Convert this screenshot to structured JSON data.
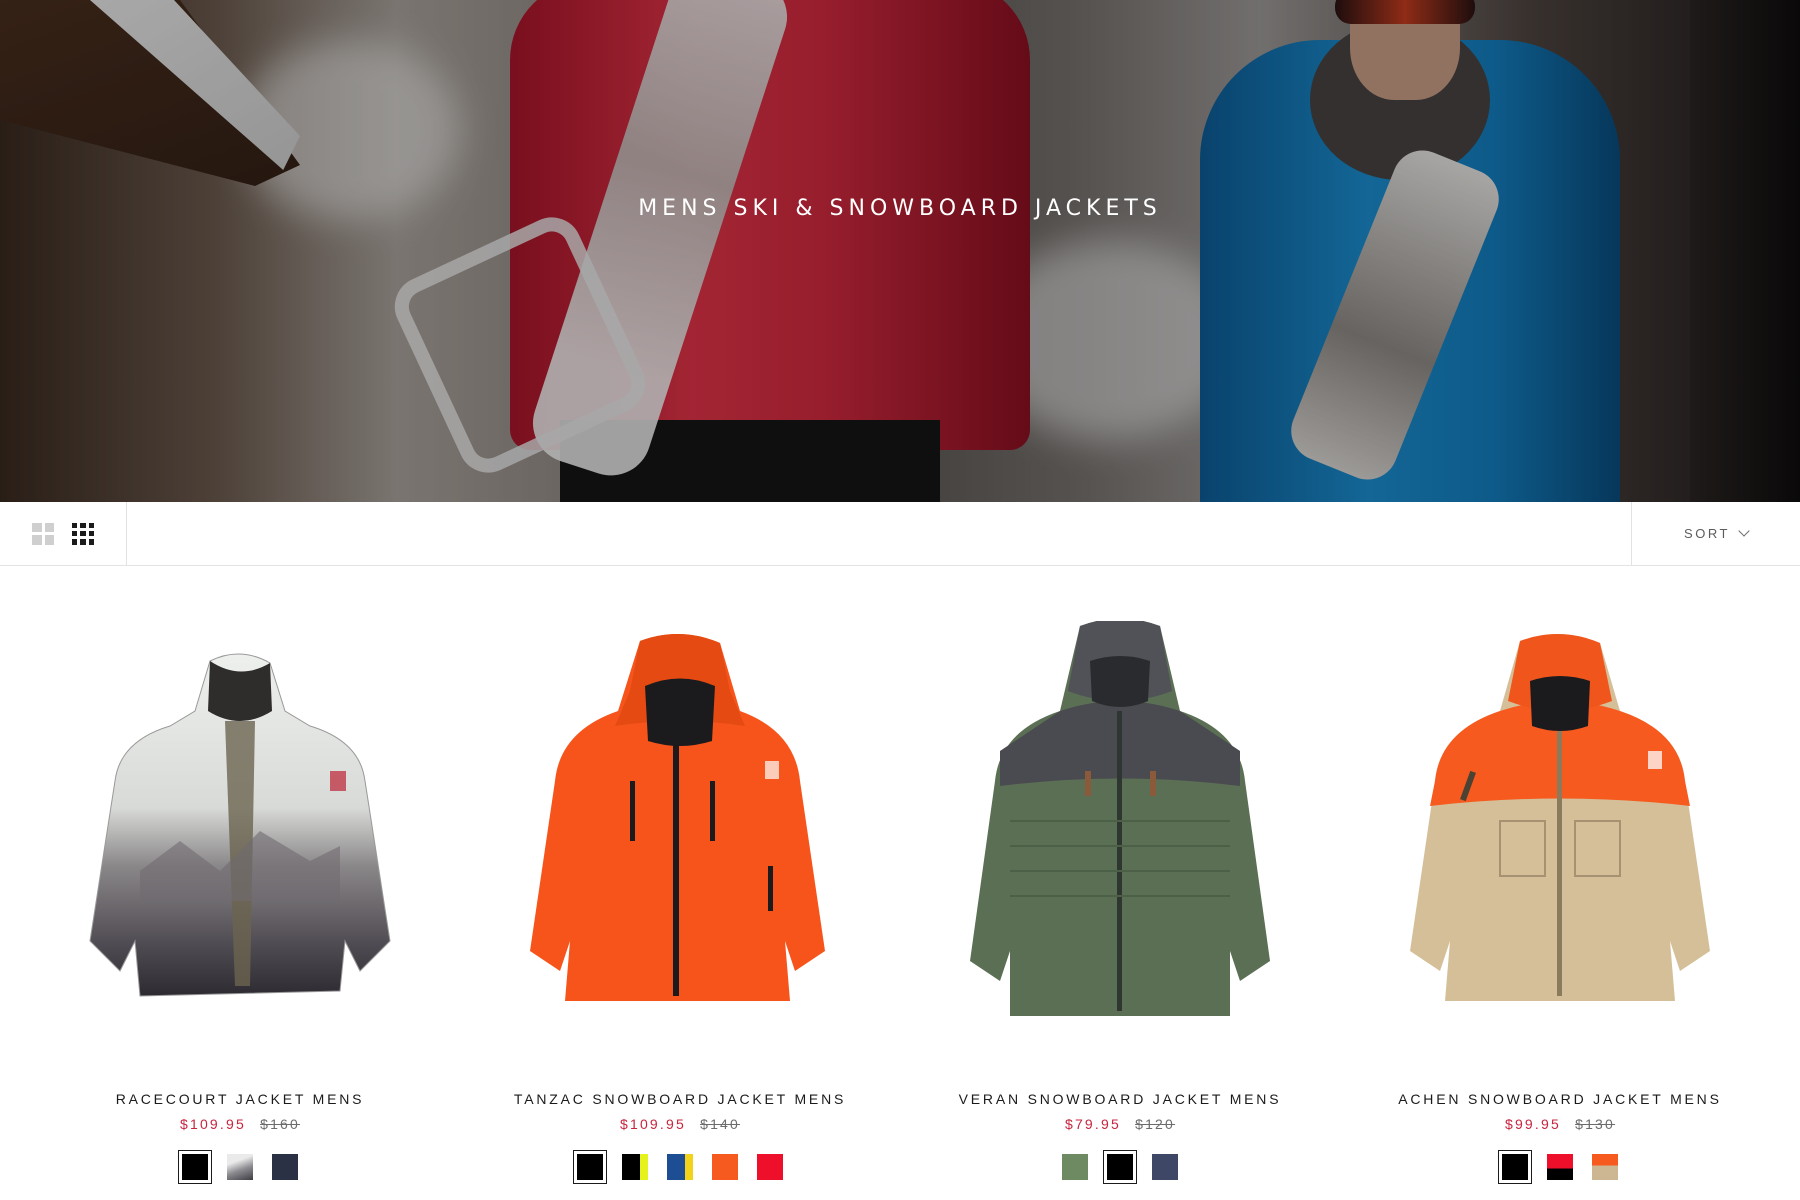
{
  "hero": {
    "title": "MENS SKI & SNOWBOARD JACKETS"
  },
  "toolbar": {
    "sort_label": "SORT",
    "view_options": [
      "grid-2-icon",
      "grid-4-icon"
    ],
    "active_view": "grid-4-icon"
  },
  "colors": {
    "sale_price": "#c7253e",
    "text": "#1c1b1b",
    "border": "#e3e3e3"
  },
  "products": [
    {
      "name": "RACECOURT JACKET MENS",
      "sale_price": "$109.95",
      "original_price": "$160",
      "swatches": [
        {
          "name": "black",
          "color": "#000000",
          "selected": true
        },
        {
          "name": "mountain-print",
          "color": "#b9b9bc",
          "selected": false
        },
        {
          "name": "navy",
          "color": "#2b3145",
          "selected": false
        }
      ]
    },
    {
      "name": "TANZAC SNOWBOARD JACKET MENS",
      "sale_price": "$109.95",
      "original_price": "$140",
      "swatches": [
        {
          "name": "black",
          "color": "#000000",
          "selected": true
        },
        {
          "name": "black-lime",
          "color": "#000000",
          "accent": "#e5f21b",
          "selected": false
        },
        {
          "name": "blue-yellow",
          "color": "#1d4d93",
          "accent": "#f2d21b",
          "selected": false
        },
        {
          "name": "orange",
          "color": "#f65a1f",
          "selected": false
        },
        {
          "name": "red",
          "color": "#ee0f2a",
          "selected": false
        }
      ]
    },
    {
      "name": "VERAN SNOWBOARD JACKET MENS",
      "sale_price": "$79.95",
      "original_price": "$120",
      "swatches": [
        {
          "name": "olive",
          "color": "#6e8a63",
          "selected": false
        },
        {
          "name": "black",
          "color": "#000000",
          "selected": true
        },
        {
          "name": "slate-blue",
          "color": "#3e4765",
          "selected": false
        }
      ]
    },
    {
      "name": "ACHEN SNOWBOARD JACKET MENS",
      "sale_price": "$99.95",
      "original_price": "$130",
      "swatches": [
        {
          "name": "black",
          "color": "#000000",
          "selected": true
        },
        {
          "name": "red-black",
          "color": "#ee0f2a",
          "accent": "#000000",
          "selected": false
        },
        {
          "name": "orange-tan",
          "color": "#f65a1f",
          "accent": "#cdb692",
          "selected": false
        }
      ]
    }
  ]
}
